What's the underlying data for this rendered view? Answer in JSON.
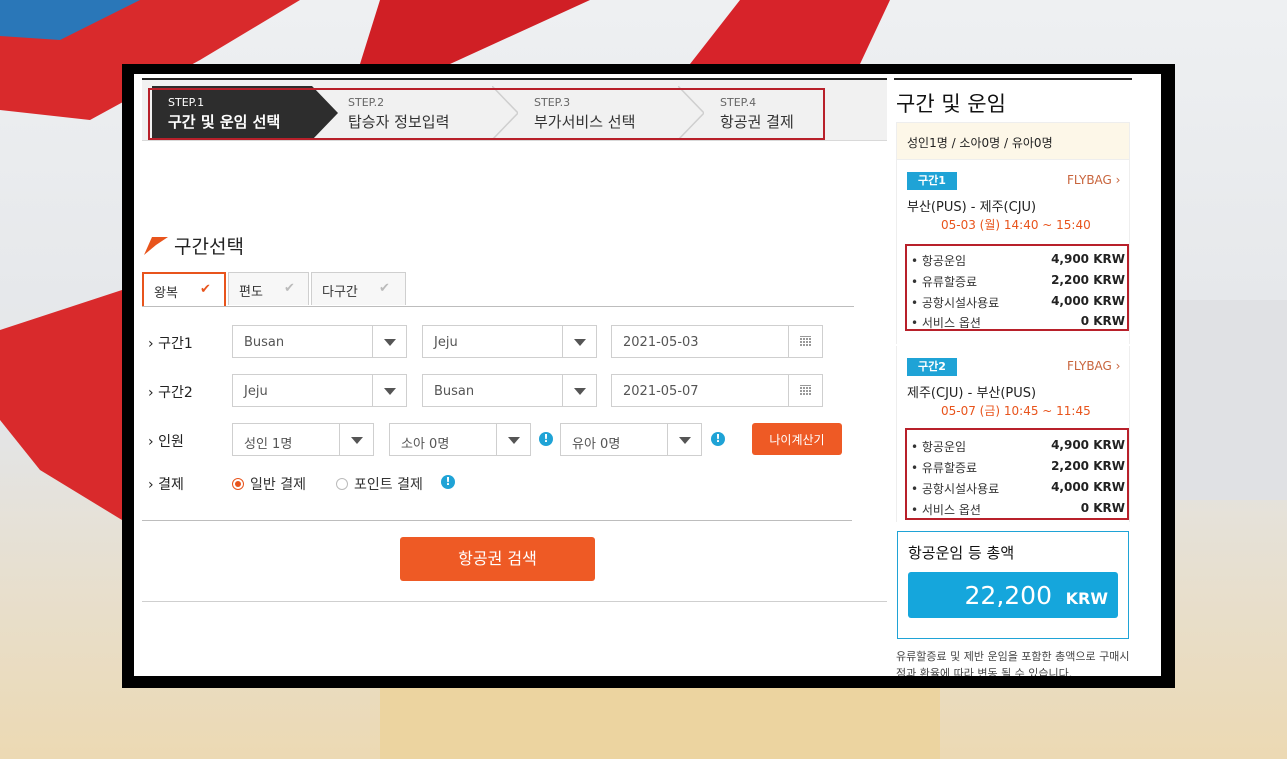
{
  "steps": [
    {
      "num": "STEP.1",
      "title": "구간 및 운임 선택",
      "active": true
    },
    {
      "num": "STEP.2",
      "title": "탑승자 정보입력",
      "active": false
    },
    {
      "num": "STEP.3",
      "title": "부가서비스 선택",
      "active": false
    },
    {
      "num": "STEP.4",
      "title": "항공권 결제",
      "active": false
    }
  ],
  "section": {
    "title": "구간선택"
  },
  "tabs": [
    {
      "label": "왕복",
      "active": true
    },
    {
      "label": "편도",
      "active": false
    },
    {
      "label": "다구간",
      "active": false
    }
  ],
  "form": {
    "seg1": {
      "label": "구간1",
      "from": "Busan",
      "to": "Jeju",
      "date": "2021-05-03"
    },
    "seg2": {
      "label": "구간2",
      "from": "Jeju",
      "to": "Busan",
      "date": "2021-05-07"
    },
    "pax": {
      "label": "인원",
      "adult": "성인 1명",
      "child": "소아 0명",
      "infant": "유아 0명",
      "age_button": "나이계산기"
    },
    "payment": {
      "label": "결제",
      "normal": "일반 결제",
      "point": "포인트 결제"
    },
    "search_button": "항공권 검색"
  },
  "summary": {
    "title": "구간 및 운임",
    "pax": "성인1명 / 소아0명 / 유아0명",
    "segments": [
      {
        "badge": "구간1",
        "flybag": "FLYBAG ›",
        "route": "부산(PUS) - 제주(CJU)",
        "time": "05-03 (월) 14:40 ~ 15:40",
        "fares": [
          {
            "label": "• 항공운임",
            "amount": "4,900 KRW"
          },
          {
            "label": "• 유류할증료",
            "amount": "2,200 KRW"
          },
          {
            "label": "• 공항시설사용료",
            "amount": "4,000 KRW"
          },
          {
            "label": "• 서비스 옵션",
            "amount": "0 KRW"
          }
        ]
      },
      {
        "badge": "구간2",
        "flybag": "FLYBAG ›",
        "route": "제주(CJU) - 부산(PUS)",
        "time": "05-07 (금) 10:45 ~ 11:45",
        "fares": [
          {
            "label": "• 항공운임",
            "amount": "4,900 KRW"
          },
          {
            "label": "• 유류할증료",
            "amount": "2,200 KRW"
          },
          {
            "label": "• 공항시설사용료",
            "amount": "4,000 KRW"
          },
          {
            "label": "• 서비스 옵션",
            "amount": "0 KRW"
          }
        ]
      }
    ],
    "total_label": "항공운임 등 총액",
    "total_value": "22,200",
    "total_currency": "KRW",
    "note": "유류할증료 및 제반 운임을 포함한 총액으로 구매시점과 환율에 따라 변동 될 수 있습니다."
  },
  "colors": {
    "accent": "#ee5a25",
    "highlight": "#b8202a",
    "blue": "#1fa3d6"
  }
}
